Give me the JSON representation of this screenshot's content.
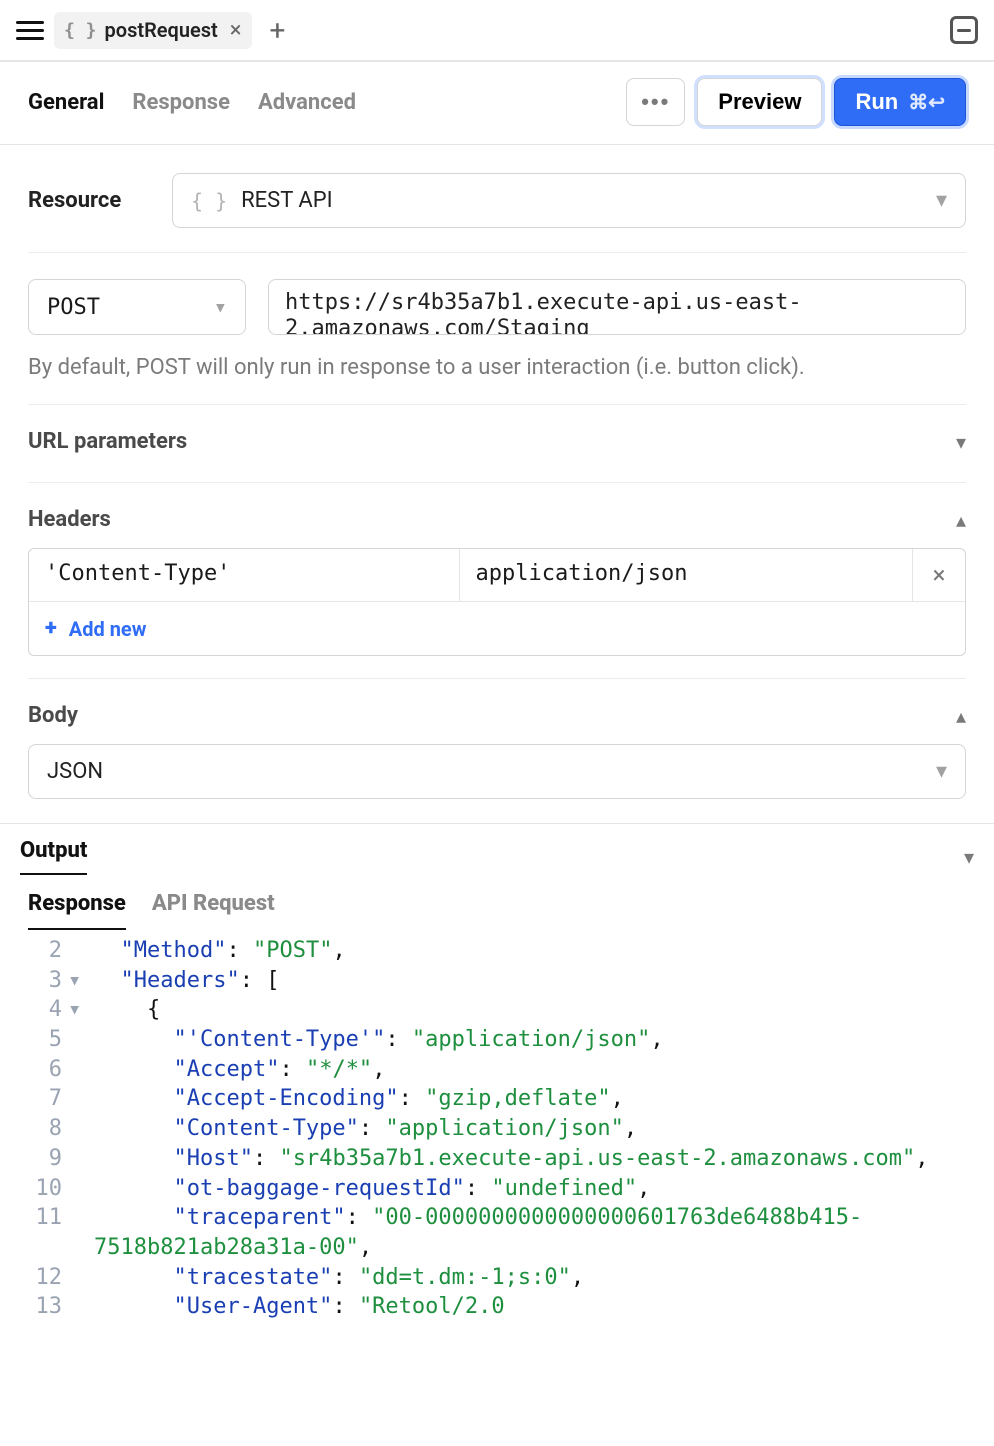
{
  "topbar": {
    "tab_icon": "{ }",
    "tab_name": "postRequest"
  },
  "subtabs": {
    "general": "General",
    "response": "Response",
    "advanced": "Advanced",
    "active": "general",
    "more": "•••",
    "preview": "Preview",
    "run": "Run",
    "run_shortcut": "⌘↩"
  },
  "resource": {
    "label": "Resource",
    "type": "REST API"
  },
  "request": {
    "method": "POST",
    "url": "https://sr4b35a7b1.execute-api.us-east-2.amazonaws.com/Staging",
    "help": "By default, POST will only run in response to a user interaction (i.e. button click)."
  },
  "sections": {
    "url_params_title": "URL parameters",
    "headers_title": "Headers",
    "body_title": "Body",
    "add_new": "Add new",
    "body_type": "JSON"
  },
  "headers": [
    {
      "key": "'Content-Type'",
      "value": "application/json"
    }
  ],
  "output": {
    "title": "Output",
    "tabs": {
      "response": "Response",
      "api_request": "API Request",
      "active": "response"
    }
  },
  "response_lines": [
    {
      "n": 2,
      "fold": "",
      "indent": 1,
      "tokens": [
        [
          "key",
          "\"Method\""
        ],
        [
          "punct",
          ": "
        ],
        [
          "str",
          "\"POST\""
        ],
        [
          "punct",
          ","
        ]
      ]
    },
    {
      "n": 3,
      "fold": "▾",
      "indent": 1,
      "tokens": [
        [
          "key",
          "\"Headers\""
        ],
        [
          "punct",
          ": "
        ],
        [
          "brack",
          "["
        ]
      ]
    },
    {
      "n": 4,
      "fold": "▾",
      "indent": 2,
      "tokens": [
        [
          "brack",
          "{"
        ]
      ]
    },
    {
      "n": 5,
      "fold": "",
      "indent": 3,
      "tokens": [
        [
          "key",
          "\"'Content-Type'\""
        ],
        [
          "punct",
          ": "
        ],
        [
          "str",
          "\"application/json\""
        ],
        [
          "punct",
          ","
        ]
      ]
    },
    {
      "n": 6,
      "fold": "",
      "indent": 3,
      "tokens": [
        [
          "key",
          "\"Accept\""
        ],
        [
          "punct",
          ": "
        ],
        [
          "str",
          "\"*/*\""
        ],
        [
          "punct",
          ","
        ]
      ]
    },
    {
      "n": 7,
      "fold": "",
      "indent": 3,
      "tokens": [
        [
          "key",
          "\"Accept-Encoding\""
        ],
        [
          "punct",
          ": "
        ],
        [
          "str",
          "\"gzip,deflate\""
        ],
        [
          "punct",
          ","
        ]
      ]
    },
    {
      "n": 8,
      "fold": "",
      "indent": 3,
      "tokens": [
        [
          "key",
          "\"Content-Type\""
        ],
        [
          "punct",
          ": "
        ],
        [
          "str",
          "\"application/json\""
        ],
        [
          "punct",
          ","
        ]
      ]
    },
    {
      "n": 9,
      "fold": "",
      "indent": 3,
      "tokens": [
        [
          "key",
          "\"Host\""
        ],
        [
          "punct",
          ": "
        ],
        [
          "str",
          "\"sr4b35a7b1.execute-api.us-east-2.amazonaws.com\""
        ],
        [
          "punct",
          ","
        ]
      ]
    },
    {
      "n": 10,
      "fold": "",
      "indent": 3,
      "tokens": [
        [
          "key",
          "\"ot-baggage-requestId\""
        ],
        [
          "punct",
          ": "
        ],
        [
          "str",
          "\"undefined\""
        ],
        [
          "punct",
          ","
        ]
      ]
    },
    {
      "n": 11,
      "fold": "",
      "indent": 3,
      "tokens": [
        [
          "key",
          "\"traceparent\""
        ],
        [
          "punct",
          ": "
        ],
        [
          "str",
          "\"00-0000000000000000601763de6488b415-7518b821ab28a31a-00\""
        ],
        [
          "punct",
          ","
        ]
      ]
    },
    {
      "n": 12,
      "fold": "",
      "indent": 3,
      "tokens": [
        [
          "key",
          "\"tracestate\""
        ],
        [
          "punct",
          ": "
        ],
        [
          "str",
          "\"dd=t.dm:-1;s:0\""
        ],
        [
          "punct",
          ","
        ]
      ]
    },
    {
      "n": 13,
      "fold": "",
      "indent": 3,
      "tokens": [
        [
          "key",
          "\"User-Agent\""
        ],
        [
          "punct",
          ": "
        ],
        [
          "str",
          "\"Retool/2.0"
        ]
      ]
    }
  ]
}
